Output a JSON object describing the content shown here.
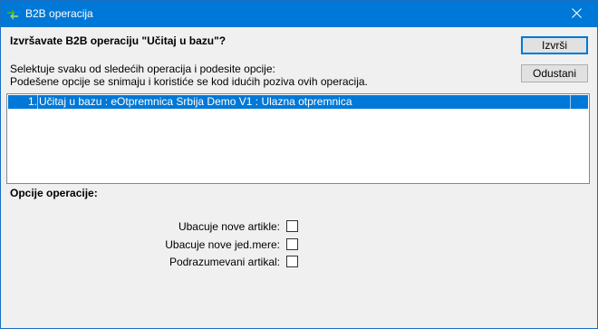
{
  "window": {
    "title": "B2B operacija"
  },
  "dialog": {
    "heading": "Izvršavate B2B operaciju \"Učitaj u bazu\"?",
    "instruction_line1": "Selektuje svaku od sledećih operacija i podesite opcije:",
    "instruction_line2": "Podešene opcije se snimaju i koristiće se kod idućih poziva ovih operacija.",
    "run_button": "Izvrši",
    "cancel_button": "Odustani"
  },
  "operations": [
    {
      "num": "1.",
      "text": "Učitaj u bazu : eOtpremnica Srbija Demo V1 : Ulazna otpremnica",
      "selected": true
    }
  ],
  "options": {
    "label": "Opcije operacije:",
    "items": [
      {
        "label": "Ubacuje nove artikle:",
        "checked": false
      },
      {
        "label": "Ubacuje nove jed.mere:",
        "checked": false
      },
      {
        "label": "Podrazumevani artikal:",
        "checked": false
      }
    ]
  },
  "icons": {
    "app": "b2b-arrows-icon",
    "close": "close-icon"
  },
  "colors": {
    "titlebar": "#0078d7",
    "selection": "#0078d7",
    "window_bg": "#f0f0f0"
  }
}
